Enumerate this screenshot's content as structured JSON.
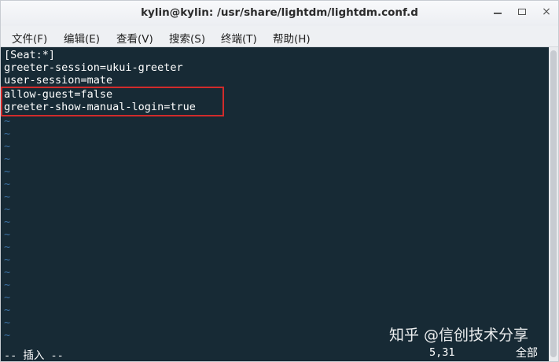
{
  "window": {
    "title": "kylin@kylin: /usr/share/lightdm/lightdm.conf.d",
    "controls": {
      "minimize": "minimize",
      "maximize": "maximize",
      "close": "×"
    }
  },
  "menubar": {
    "items": [
      {
        "label": "文件(F)"
      },
      {
        "label": "编辑(E)"
      },
      {
        "label": "查看(V)"
      },
      {
        "label": "搜索(S)"
      },
      {
        "label": "终端(T)"
      },
      {
        "label": "帮助(H)"
      }
    ]
  },
  "terminal": {
    "lines": [
      "[Seat:*]",
      "greeter-session=ukui-greeter",
      "user-session=mate",
      "allow-guest=false",
      "greeter-show-manual-login=true"
    ],
    "tilde": "~",
    "status": {
      "mode": "-- 插入 --",
      "position": "5,31",
      "scroll": "全部"
    },
    "colors": {
      "background": "#172a35",
      "text": "#ffffff",
      "tilde": "#3b6fa0",
      "highlight": "#d12b2b"
    }
  },
  "watermark": {
    "text": "知乎 @信创技术分享"
  }
}
